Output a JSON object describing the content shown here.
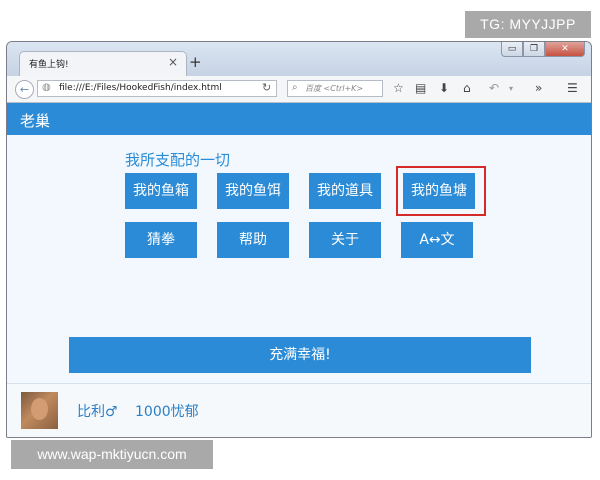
{
  "watermarks": {
    "top": "TG: MYYJJPP",
    "bottom": "www.wap-mktiyucn.com"
  },
  "browser": {
    "tab_title": "有鱼上钩!",
    "tab_close": "×",
    "new_tab": "+",
    "url": "file:///E:/Files/HookedFish/index.html",
    "search_placeholder": "百度 <Ctrl+K>",
    "window_controls": {
      "minimize": "▭",
      "maximize": "❐",
      "close": "✕"
    }
  },
  "app": {
    "title": "老巢"
  },
  "main": {
    "section_title": "我所支配的一切",
    "buttons_row1": [
      "我的鱼箱",
      "我的鱼饵",
      "我的道具",
      "我的鱼塘"
    ],
    "buttons_row2": [
      "猜拳",
      "帮助",
      "关于",
      "A↔文"
    ],
    "wide_button": "充满幸福!"
  },
  "user": {
    "name": "比利♂",
    "coins": "1000忧郁"
  },
  "icons": [
    "back-icon",
    "globe-icon",
    "reload-icon",
    "search-icon",
    "bookmark-star-icon",
    "reader-icon",
    "download-icon",
    "home-icon",
    "undo-icon",
    "overflow-icon",
    "menu-icon"
  ],
  "colors": {
    "accent": "#2b8bd6",
    "highlight_border": "#d42a2a",
    "content_bg": "#f2f8fd"
  }
}
